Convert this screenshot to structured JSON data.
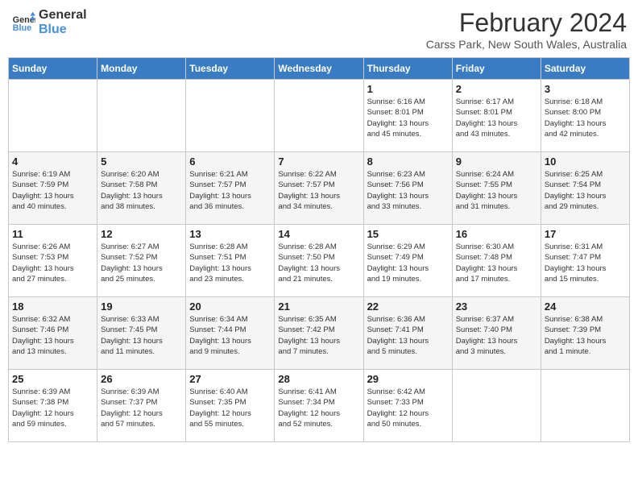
{
  "header": {
    "logo_line1": "General",
    "logo_line2": "Blue",
    "month_title": "February 2024",
    "location": "Carss Park, New South Wales, Australia"
  },
  "days": [
    "Sunday",
    "Monday",
    "Tuesday",
    "Wednesday",
    "Thursday",
    "Friday",
    "Saturday"
  ],
  "weeks": [
    [
      {
        "date": "",
        "info": ""
      },
      {
        "date": "",
        "info": ""
      },
      {
        "date": "",
        "info": ""
      },
      {
        "date": "",
        "info": ""
      },
      {
        "date": "1",
        "info": "Sunrise: 6:16 AM\nSunset: 8:01 PM\nDaylight: 13 hours\nand 45 minutes."
      },
      {
        "date": "2",
        "info": "Sunrise: 6:17 AM\nSunset: 8:01 PM\nDaylight: 13 hours\nand 43 minutes."
      },
      {
        "date": "3",
        "info": "Sunrise: 6:18 AM\nSunset: 8:00 PM\nDaylight: 13 hours\nand 42 minutes."
      }
    ],
    [
      {
        "date": "4",
        "info": "Sunrise: 6:19 AM\nSunset: 7:59 PM\nDaylight: 13 hours\nand 40 minutes."
      },
      {
        "date": "5",
        "info": "Sunrise: 6:20 AM\nSunset: 7:58 PM\nDaylight: 13 hours\nand 38 minutes."
      },
      {
        "date": "6",
        "info": "Sunrise: 6:21 AM\nSunset: 7:57 PM\nDaylight: 13 hours\nand 36 minutes."
      },
      {
        "date": "7",
        "info": "Sunrise: 6:22 AM\nSunset: 7:57 PM\nDaylight: 13 hours\nand 34 minutes."
      },
      {
        "date": "8",
        "info": "Sunrise: 6:23 AM\nSunset: 7:56 PM\nDaylight: 13 hours\nand 33 minutes."
      },
      {
        "date": "9",
        "info": "Sunrise: 6:24 AM\nSunset: 7:55 PM\nDaylight: 13 hours\nand 31 minutes."
      },
      {
        "date": "10",
        "info": "Sunrise: 6:25 AM\nSunset: 7:54 PM\nDaylight: 13 hours\nand 29 minutes."
      }
    ],
    [
      {
        "date": "11",
        "info": "Sunrise: 6:26 AM\nSunset: 7:53 PM\nDaylight: 13 hours\nand 27 minutes."
      },
      {
        "date": "12",
        "info": "Sunrise: 6:27 AM\nSunset: 7:52 PM\nDaylight: 13 hours\nand 25 minutes."
      },
      {
        "date": "13",
        "info": "Sunrise: 6:28 AM\nSunset: 7:51 PM\nDaylight: 13 hours\nand 23 minutes."
      },
      {
        "date": "14",
        "info": "Sunrise: 6:28 AM\nSunset: 7:50 PM\nDaylight: 13 hours\nand 21 minutes."
      },
      {
        "date": "15",
        "info": "Sunrise: 6:29 AM\nSunset: 7:49 PM\nDaylight: 13 hours\nand 19 minutes."
      },
      {
        "date": "16",
        "info": "Sunrise: 6:30 AM\nSunset: 7:48 PM\nDaylight: 13 hours\nand 17 minutes."
      },
      {
        "date": "17",
        "info": "Sunrise: 6:31 AM\nSunset: 7:47 PM\nDaylight: 13 hours\nand 15 minutes."
      }
    ],
    [
      {
        "date": "18",
        "info": "Sunrise: 6:32 AM\nSunset: 7:46 PM\nDaylight: 13 hours\nand 13 minutes."
      },
      {
        "date": "19",
        "info": "Sunrise: 6:33 AM\nSunset: 7:45 PM\nDaylight: 13 hours\nand 11 minutes."
      },
      {
        "date": "20",
        "info": "Sunrise: 6:34 AM\nSunset: 7:44 PM\nDaylight: 13 hours\nand 9 minutes."
      },
      {
        "date": "21",
        "info": "Sunrise: 6:35 AM\nSunset: 7:42 PM\nDaylight: 13 hours\nand 7 minutes."
      },
      {
        "date": "22",
        "info": "Sunrise: 6:36 AM\nSunset: 7:41 PM\nDaylight: 13 hours\nand 5 minutes."
      },
      {
        "date": "23",
        "info": "Sunrise: 6:37 AM\nSunset: 7:40 PM\nDaylight: 13 hours\nand 3 minutes."
      },
      {
        "date": "24",
        "info": "Sunrise: 6:38 AM\nSunset: 7:39 PM\nDaylight: 13 hours\nand 1 minute."
      }
    ],
    [
      {
        "date": "25",
        "info": "Sunrise: 6:39 AM\nSunset: 7:38 PM\nDaylight: 12 hours\nand 59 minutes."
      },
      {
        "date": "26",
        "info": "Sunrise: 6:39 AM\nSunset: 7:37 PM\nDaylight: 12 hours\nand 57 minutes."
      },
      {
        "date": "27",
        "info": "Sunrise: 6:40 AM\nSunset: 7:35 PM\nDaylight: 12 hours\nand 55 minutes."
      },
      {
        "date": "28",
        "info": "Sunrise: 6:41 AM\nSunset: 7:34 PM\nDaylight: 12 hours\nand 52 minutes."
      },
      {
        "date": "29",
        "info": "Sunrise: 6:42 AM\nSunset: 7:33 PM\nDaylight: 12 hours\nand 50 minutes."
      },
      {
        "date": "",
        "info": ""
      },
      {
        "date": "",
        "info": ""
      }
    ]
  ]
}
